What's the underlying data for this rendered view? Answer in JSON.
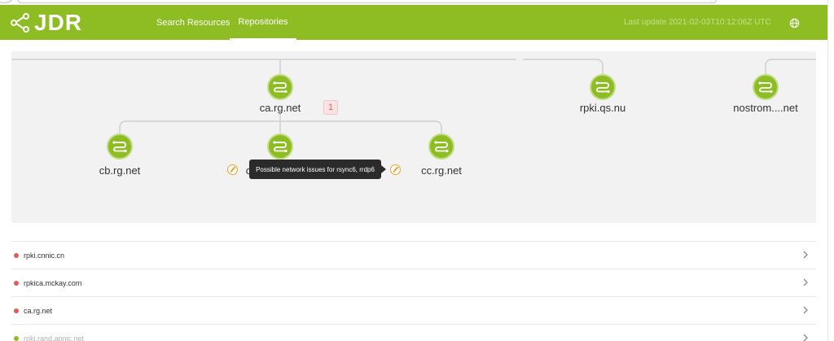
{
  "header": {
    "logo_text": "JDR",
    "nav": [
      "Search Resources",
      "Repositories"
    ],
    "last_update": "Last update 2021-02-03T10:12:06Z UTC",
    "accent_color": "#8dbc23"
  },
  "graph": {
    "nodes": [
      {
        "label": "ca.rg.net"
      },
      {
        "label": "rpki.qs.nu"
      },
      {
        "label": "nostrom....net"
      },
      {
        "label": "cb.rg.net"
      },
      {
        "label": "c"
      },
      {
        "label": "cc.rg.net"
      }
    ],
    "badge_count": "1",
    "tooltip": "Possible network issues for rsync6, rrdp6"
  },
  "repositories": [
    {
      "name": "rpki.cnnic.cn",
      "status": "error"
    },
    {
      "name": "rpkica.mckay.com",
      "status": "error"
    },
    {
      "name": "ca.rg.net",
      "status": "error"
    },
    {
      "name": "rpki.rand.apnic.net",
      "status": "ok"
    }
  ]
}
